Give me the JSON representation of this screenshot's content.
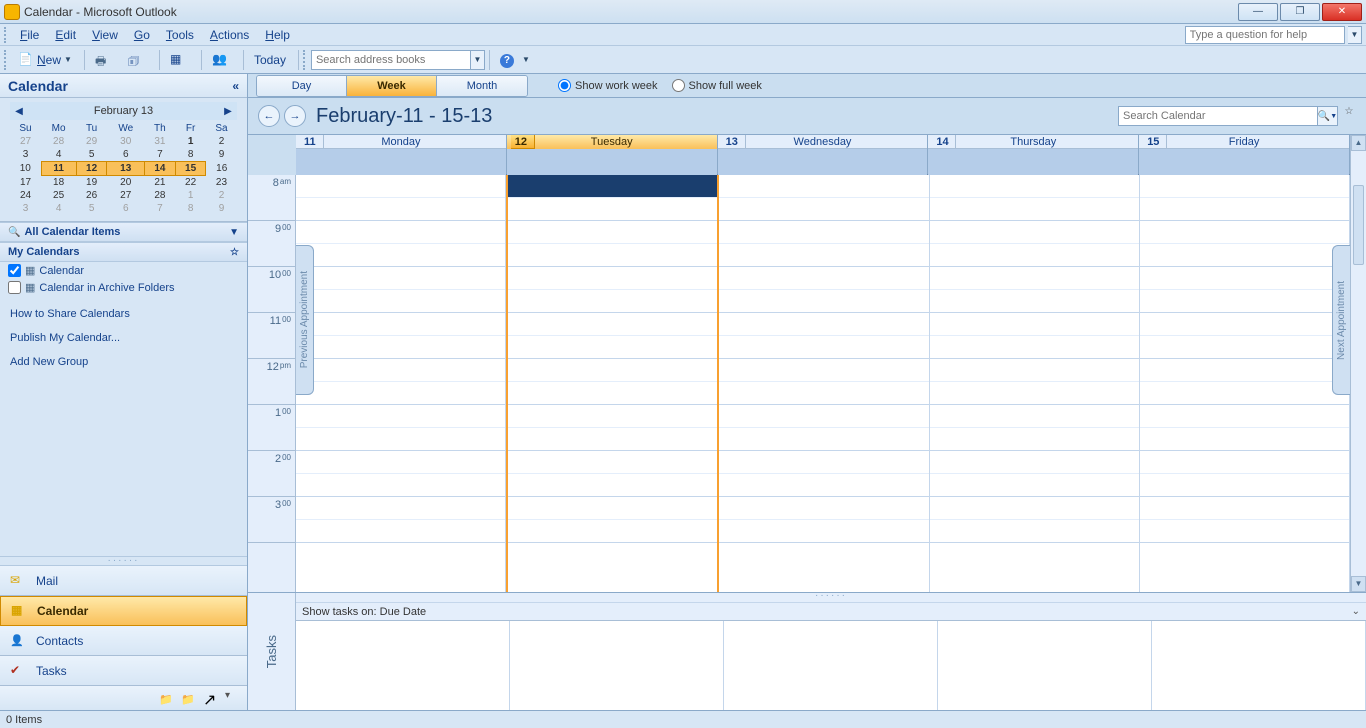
{
  "window": {
    "title": "Calendar - Microsoft Outlook"
  },
  "menubar": {
    "items": [
      "File",
      "Edit",
      "View",
      "Go",
      "Tools",
      "Actions",
      "Help"
    ],
    "help_placeholder": "Type a question for help"
  },
  "toolbar": {
    "new_label": "New",
    "today_label": "Today",
    "address_placeholder": "Search address books"
  },
  "nav": {
    "header": "Calendar",
    "month_label": "February 13",
    "weekdays": [
      "Su",
      "Mo",
      "Tu",
      "We",
      "Th",
      "Fr",
      "Sa"
    ],
    "weeks": [
      [
        {
          "n": "27",
          "dim": true
        },
        {
          "n": "28",
          "dim": true
        },
        {
          "n": "29",
          "dim": true
        },
        {
          "n": "30",
          "dim": true
        },
        {
          "n": "31",
          "dim": true
        },
        {
          "n": "1",
          "bold": true
        },
        {
          "n": "2"
        }
      ],
      [
        {
          "n": "3"
        },
        {
          "n": "4"
        },
        {
          "n": "5"
        },
        {
          "n": "6"
        },
        {
          "n": "7"
        },
        {
          "n": "8"
        },
        {
          "n": "9"
        }
      ],
      [
        {
          "n": "10"
        },
        {
          "n": "11",
          "hl": true
        },
        {
          "n": "12",
          "hl": true
        },
        {
          "n": "13",
          "hl": true
        },
        {
          "n": "14",
          "hl": true
        },
        {
          "n": "15",
          "hl": true
        },
        {
          "n": "16"
        }
      ],
      [
        {
          "n": "17"
        },
        {
          "n": "18"
        },
        {
          "n": "19"
        },
        {
          "n": "20"
        },
        {
          "n": "21"
        },
        {
          "n": "22"
        },
        {
          "n": "23"
        }
      ],
      [
        {
          "n": "24"
        },
        {
          "n": "25"
        },
        {
          "n": "26"
        },
        {
          "n": "27"
        },
        {
          "n": "28"
        },
        {
          "n": "1",
          "dim": true
        },
        {
          "n": "2",
          "dim": true
        }
      ],
      [
        {
          "n": "3",
          "dim": true
        },
        {
          "n": "4",
          "dim": true
        },
        {
          "n": "5",
          "dim": true
        },
        {
          "n": "6",
          "dim": true
        },
        {
          "n": "7",
          "dim": true
        },
        {
          "n": "8",
          "dim": true
        },
        {
          "n": "9",
          "dim": true
        }
      ]
    ],
    "all_items": "All Calendar Items",
    "my_calendars": "My Calendars",
    "cal1": "Calendar",
    "cal2": "Calendar in Archive Folders",
    "links": [
      "How to Share Calendars",
      "Publish My Calendar...",
      "Add New Group"
    ],
    "buttons": {
      "mail": "Mail",
      "calendar": "Calendar",
      "contacts": "Contacts",
      "tasks": "Tasks"
    }
  },
  "view": {
    "tabs": {
      "day": "Day",
      "week": "Week",
      "month": "Month"
    },
    "radio1": "Show work week",
    "radio2": "Show full week",
    "range": "February-11 - 15-13",
    "search_placeholder": "Search Calendar",
    "days": [
      {
        "num": "11",
        "name": "Monday",
        "today": false
      },
      {
        "num": "12",
        "name": "Tuesday",
        "today": true
      },
      {
        "num": "13",
        "name": "Wednesday",
        "today": false
      },
      {
        "num": "14",
        "name": "Thursday",
        "today": false
      },
      {
        "num": "15",
        "name": "Friday",
        "today": false
      }
    ],
    "hours": [
      {
        "h": "8",
        "m": "am"
      },
      {
        "h": "9",
        "m": "00"
      },
      {
        "h": "10",
        "m": "00"
      },
      {
        "h": "11",
        "m": "00"
      },
      {
        "h": "12",
        "m": "pm"
      },
      {
        "h": "1",
        "m": "00"
      },
      {
        "h": "2",
        "m": "00"
      },
      {
        "h": "3",
        "m": "00"
      }
    ],
    "prev_appt": "Previous Appointment",
    "next_appt": "Next Appointment"
  },
  "tasks": {
    "label": "Tasks",
    "header": "Show tasks on: Due Date"
  },
  "status": {
    "items": "0 Items"
  }
}
